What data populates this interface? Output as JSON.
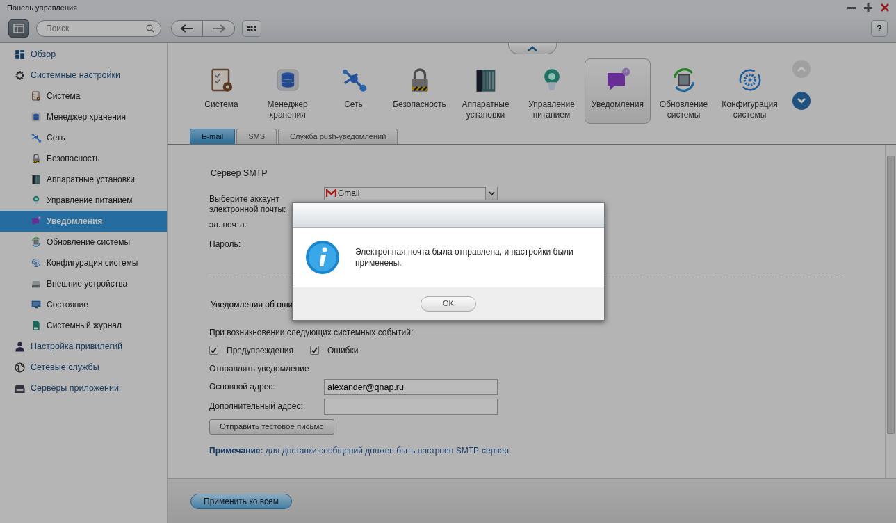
{
  "window": {
    "title": "Панель управления"
  },
  "toolbar": {
    "search": {
      "placeholder": "Поиск"
    },
    "help": "?"
  },
  "sidebar": {
    "items": [
      {
        "label": "Обзор",
        "selected": false
      },
      {
        "label": "Системные настройки",
        "selected": false,
        "children": [
          {
            "label": "Система",
            "selected": false
          },
          {
            "label": "Менеджер хранения",
            "selected": false
          },
          {
            "label": "Сеть",
            "selected": false
          },
          {
            "label": "Безопасность",
            "selected": false
          },
          {
            "label": "Аппаратные установки",
            "selected": false
          },
          {
            "label": "Управление питанием",
            "selected": false
          },
          {
            "label": "Уведомления",
            "selected": true
          },
          {
            "label": "Обновление системы",
            "selected": false
          },
          {
            "label": "Конфигурация системы",
            "selected": false
          },
          {
            "label": "Внешние устройства",
            "selected": false
          },
          {
            "label": "Состояние",
            "selected": false
          },
          {
            "label": "Системный журнал",
            "selected": false
          }
        ]
      },
      {
        "label": "Настройка привилегий",
        "selected": false
      },
      {
        "label": "Сетевые службы",
        "selected": false
      },
      {
        "label": "Серверы приложений",
        "selected": false
      }
    ]
  },
  "apps": [
    {
      "label": "Система",
      "selected": false
    },
    {
      "label": "Менеджер хранения",
      "selected": false
    },
    {
      "label": "Сеть",
      "selected": false
    },
    {
      "label": "Безопасность",
      "selected": false
    },
    {
      "label": "Аппаратные установки",
      "selected": false
    },
    {
      "label": "Управление питанием",
      "selected": false
    },
    {
      "label": "Уведомления",
      "selected": true
    },
    {
      "label": "Обновление системы",
      "selected": false
    },
    {
      "label": "Конфигурация системы",
      "selected": false
    }
  ],
  "tabs": [
    {
      "label": "E-mail",
      "selected": true
    },
    {
      "label": "SMS",
      "selected": false
    },
    {
      "label": "Служба push-уведомлений",
      "selected": false
    }
  ],
  "smtp": {
    "heading": "Сервер SMTP",
    "account_label": "Выберите аккаунт электронной почты:",
    "account_value": "Gmail",
    "email_label": "эл. почта:",
    "password_label": "Пароль:"
  },
  "alerts": {
    "heading": "Уведомления об оши",
    "events_label": "При возникновении следующих системных событий:",
    "events": [
      {
        "label": "Предупреждения",
        "checked": true
      },
      {
        "label": "Ошибки",
        "checked": true
      }
    ],
    "send_label": "Отправлять уведомление",
    "primary": {
      "label": "Основной адрес:",
      "value": "alexander@qnap.ru"
    },
    "secondary": {
      "label": "Дополнительный адрес:"
    },
    "test_button": "Отправить тестовое письмо",
    "note": "**Примечание:** для доставки сообщений должен быть настроен SMTP-сервер."
  },
  "footer": {
    "apply_button": "Применить ко всем"
  },
  "dialog": {
    "message": "Электронная почта была отправлена, и настройки были применены.",
    "ok": "OK"
  }
}
